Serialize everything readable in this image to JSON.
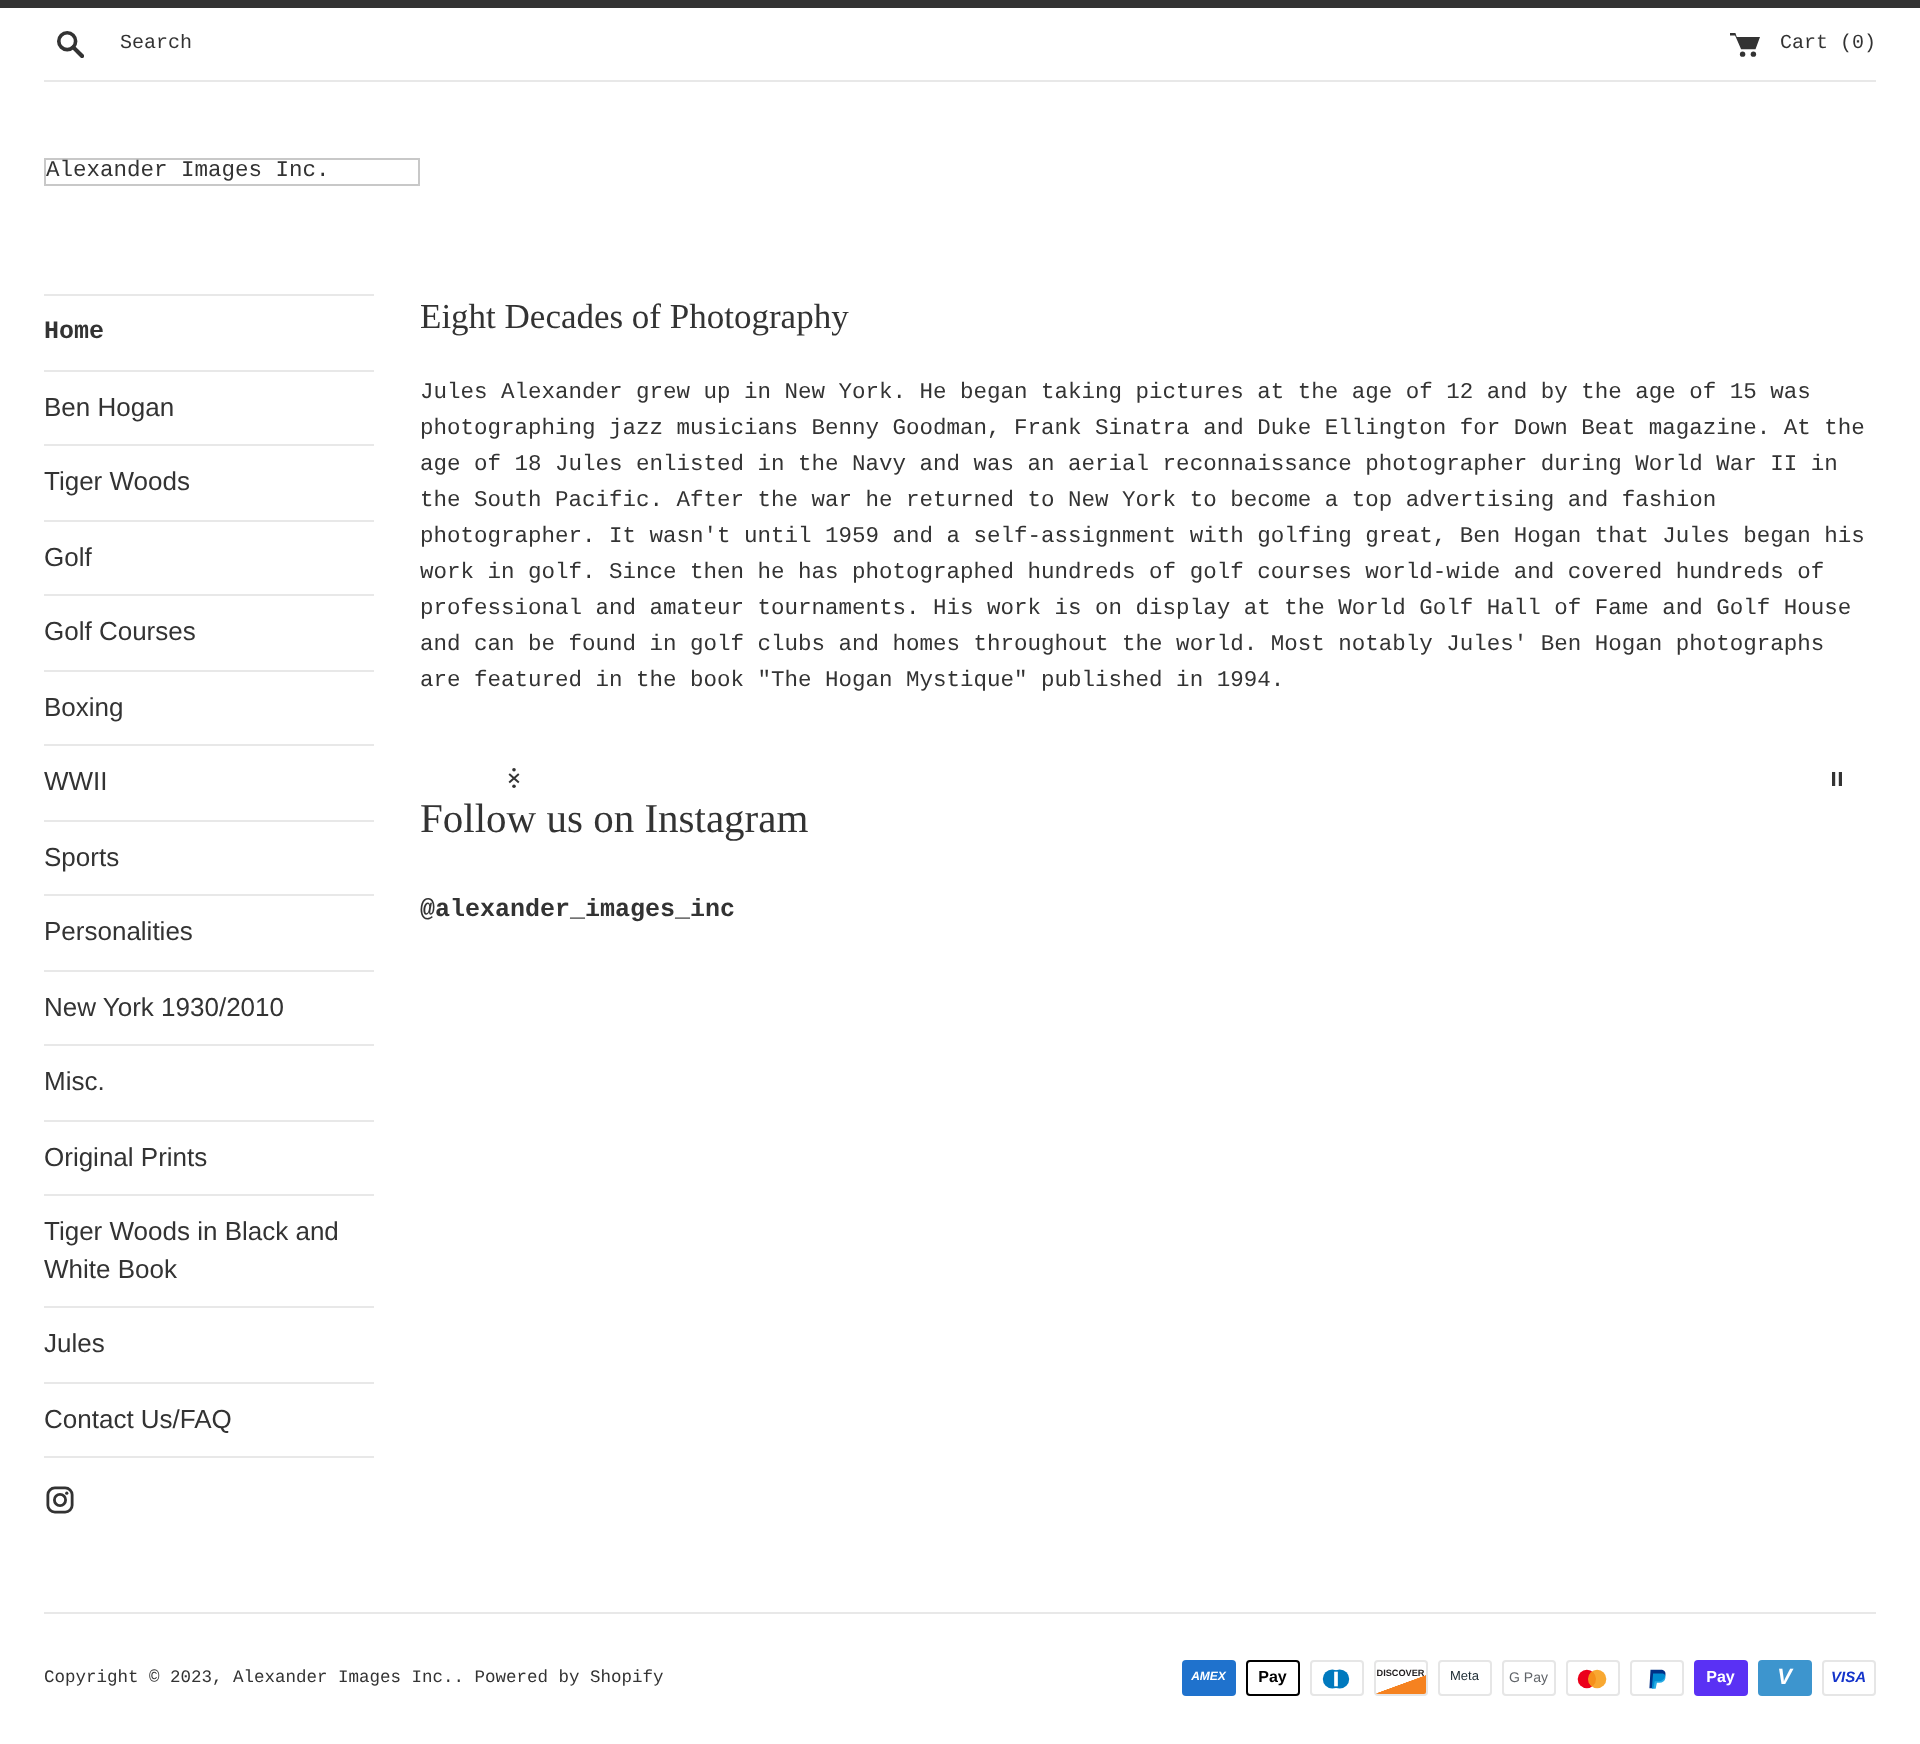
{
  "header": {
    "search": {
      "placeholder": "Search"
    },
    "cart": {
      "label": "Cart (0)"
    }
  },
  "logo": {
    "alt_text": "Alexander Images Inc."
  },
  "sidebar": {
    "items": [
      {
        "label": "Home",
        "selected": true
      },
      {
        "label": "Ben Hogan",
        "selected": false
      },
      {
        "label": "Tiger Woods",
        "selected": false
      },
      {
        "label": "Golf",
        "selected": false
      },
      {
        "label": "Golf Courses",
        "selected": false
      },
      {
        "label": "Boxing",
        "selected": false
      },
      {
        "label": "WWII",
        "selected": false
      },
      {
        "label": "Sports",
        "selected": false
      },
      {
        "label": "Personalities",
        "selected": false
      },
      {
        "label": "New York 1930/2010",
        "selected": false
      },
      {
        "label": "Misc.",
        "selected": false
      },
      {
        "label": "Original Prints",
        "selected": false
      },
      {
        "label": "Tiger Woods in Black and White Book",
        "selected": false
      },
      {
        "label": "Jules",
        "selected": false
      },
      {
        "label": "Contact Us/FAQ",
        "selected": false
      }
    ]
  },
  "main": {
    "title": "Eight Decades of Photography",
    "body": "Jules Alexander grew up in New York. He began taking pictures at the age of 12 and by the age of 15 was photographing jazz musicians Benny Goodman, Frank Sinatra and Duke Ellington for Down Beat magazine. At the age of 18 Jules enlisted in the Navy and was an aerial reconnaissance photographer during World War II in the South Pacific. After the war he returned to New York to become a top advertising and fashion photographer. It wasn't until 1959 and a self-assignment with golfing great, Ben Hogan that Jules began his work in golf. Since then he has photographed hundreds of golf courses world-wide and covered hundreds of professional and amateur tournaments. His work is on display at the World Golf Hall of Fame and Golf House and can be found in golf clubs and homes throughout the world. Most notably Jules' Ben Hogan photographs are featured in the book \"The Hogan Mystique\" published in 1994.",
    "instagram": {
      "title": "Follow us on Instagram",
      "handle": "@alexander_images_inc"
    }
  },
  "footer": {
    "copyright": "Copyright © 2023, Alexander Images Inc.. Powered by Shopify",
    "payment_icons": [
      {
        "kind": "amex",
        "label": "AMEX"
      },
      {
        "kind": "apple_pay",
        "label": "Pay"
      },
      {
        "kind": "diners"
      },
      {
        "kind": "discover",
        "label": "DISCOVER"
      },
      {
        "kind": "meta_pay",
        "label": "Meta"
      },
      {
        "kind": "google_pay",
        "label": "G Pay"
      },
      {
        "kind": "master"
      },
      {
        "kind": "paypal"
      },
      {
        "kind": "shop_pay",
        "label": "Pay"
      },
      {
        "kind": "venmo",
        "label": "V"
      },
      {
        "kind": "visa",
        "label": "VISA"
      }
    ]
  }
}
